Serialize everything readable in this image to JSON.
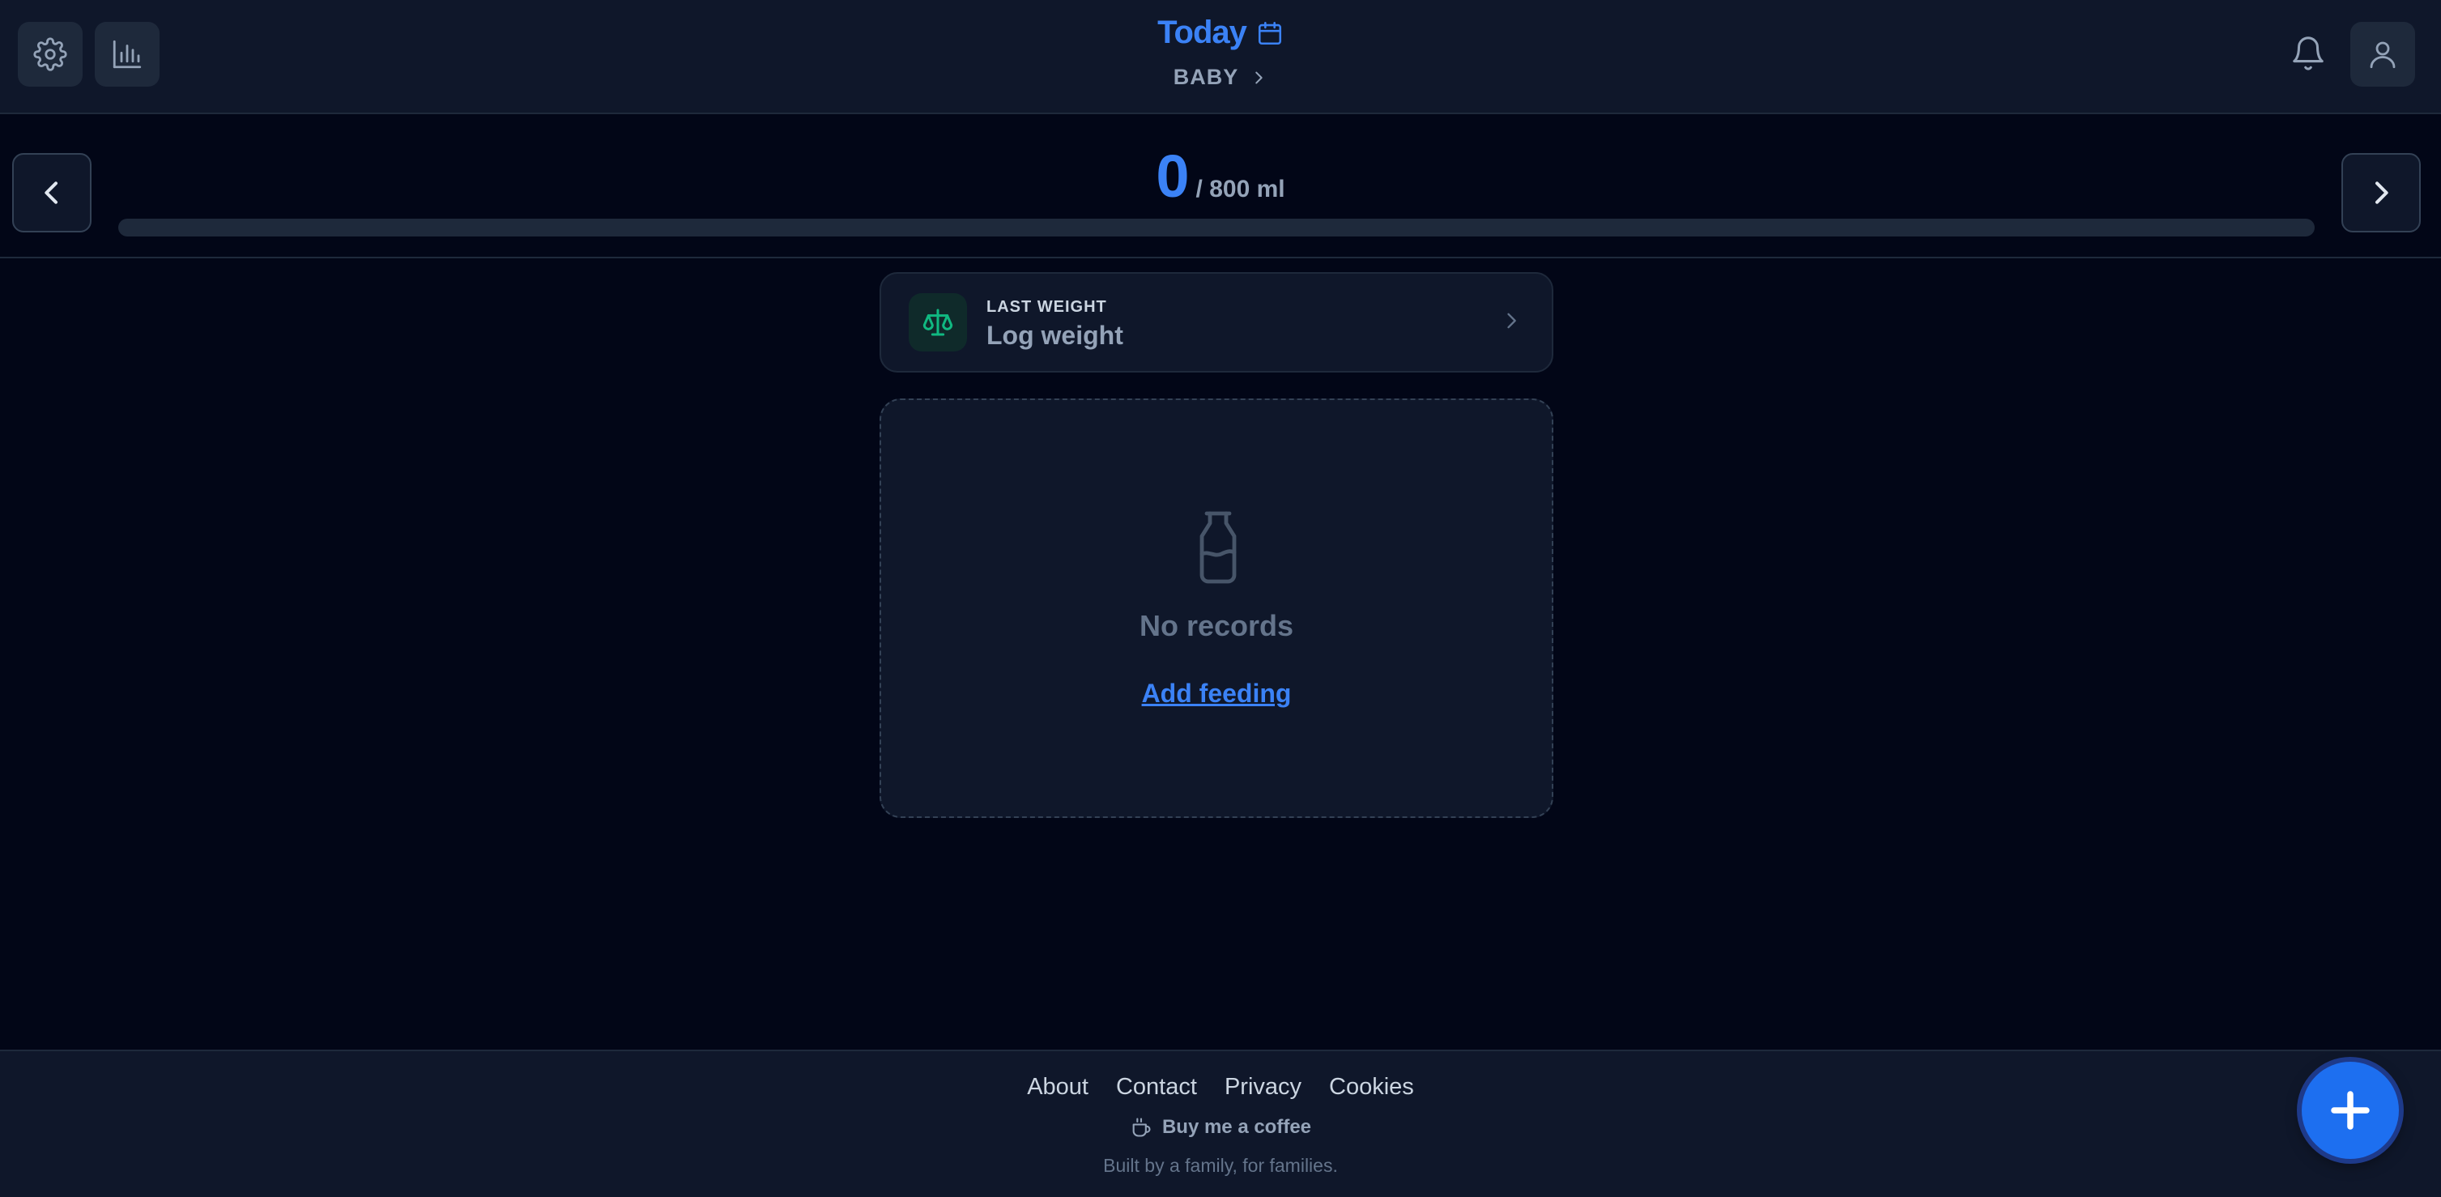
{
  "header": {
    "title": "Today",
    "subtitle": "BABY",
    "icons": {
      "settings": "gear-icon",
      "stats": "bar-chart-icon",
      "calendar": "calendar-icon",
      "notifications": "bell-icon",
      "profile": "user-icon"
    }
  },
  "progress": {
    "current": "0",
    "total_label": "/ 800 ml",
    "fraction": 0
  },
  "weight_card": {
    "label": "LAST WEIGHT",
    "value": "Log weight",
    "icon": "scale-icon"
  },
  "empty_state": {
    "title": "No records",
    "action": "Add feeding",
    "icon": "bottle-icon"
  },
  "footer": {
    "links": [
      "About",
      "Contact",
      "Privacy",
      "Cookies"
    ],
    "coffee": "Buy me a coffee",
    "tagline": "Built by a family, for families."
  },
  "colors": {
    "accent": "#3b82f6",
    "background": "#020617",
    "surface": "#0f172a",
    "scale_green": "#10b981"
  }
}
